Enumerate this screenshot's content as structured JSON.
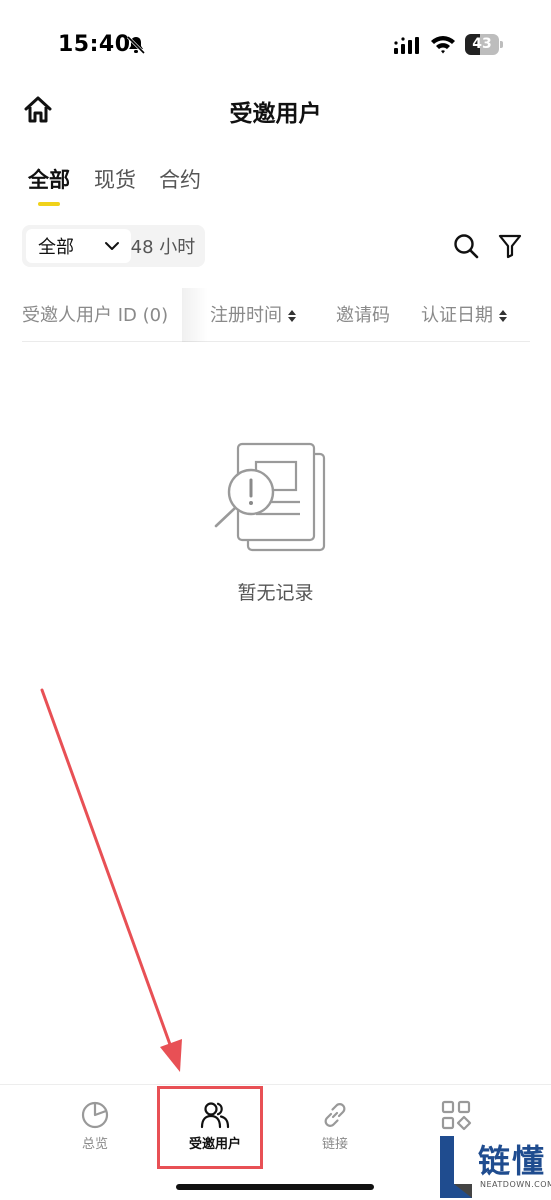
{
  "status_bar": {
    "time": "15:40",
    "battery_level": 43,
    "battery_text": "43",
    "icons": [
      "bell-slash-icon",
      "signal-icon",
      "wifi-icon",
      "battery-icon"
    ]
  },
  "header": {
    "title": "受邀用户",
    "home_icon": "home-icon"
  },
  "tabs": [
    {
      "label": "全部",
      "active": true
    },
    {
      "label": "现货",
      "active": false
    },
    {
      "label": "合约",
      "active": false
    }
  ],
  "filters": {
    "scope_selected": "全部",
    "time_range": "48 小时",
    "search_icon": "search-icon",
    "filter_icon": "filter-icon"
  },
  "table": {
    "columns": [
      {
        "label": "受邀人用户 ID (0)",
        "sortable": false
      },
      {
        "label": "注册时间",
        "sortable": true
      },
      {
        "label": "邀请码",
        "sortable": false
      },
      {
        "label": "认证日期",
        "sortable": true
      }
    ],
    "rows": []
  },
  "empty_state": {
    "text": "暂无记录",
    "icon": "empty-document-icon"
  },
  "tabbar": {
    "items": [
      {
        "label": "总览",
        "icon": "pie-chart-icon",
        "active": false
      },
      {
        "label": "受邀用户",
        "icon": "users-icon",
        "active": true
      },
      {
        "label": "链接",
        "icon": "link-icon",
        "active": false
      },
      {
        "label": "",
        "icon": "apps-grid-icon",
        "active": false
      }
    ]
  },
  "annotation": {
    "color": "#e85055"
  },
  "watermark": {
    "text": "链懂",
    "subtext": "NEATDOWN.COM"
  },
  "colors": {
    "accent": "#f0d21a",
    "annotation": "#e85055",
    "muted_text": "#8a8a8a"
  }
}
